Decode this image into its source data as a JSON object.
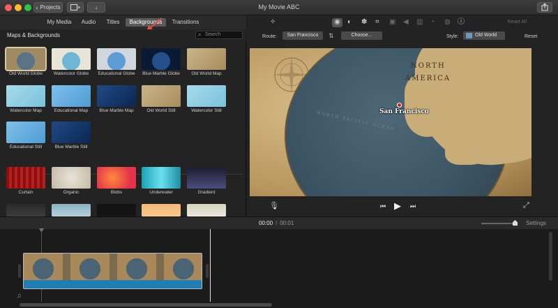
{
  "window": {
    "title": "My Movie ABC",
    "projects_label": "Projects"
  },
  "browser": {
    "tabs": [
      "My Media",
      "Audio",
      "Titles",
      "Backgrounds",
      "Transitions"
    ],
    "active_tab": "Backgrounds",
    "section_title": "Maps & Backgrounds",
    "search_placeholder": "Search",
    "maps": [
      {
        "label": "Old World Globe",
        "selected": true
      },
      {
        "label": "Watercolor Globe"
      },
      {
        "label": "Educational Globe"
      },
      {
        "label": "Blue Marble Globe"
      },
      {
        "label": "Old World Map"
      },
      {
        "label": "Watercolor Map"
      },
      {
        "label": "Educational Map"
      },
      {
        "label": "Blue Marble Map"
      },
      {
        "label": "Old World Still"
      },
      {
        "label": "Watercolor Still"
      },
      {
        "label": "Educational Still"
      },
      {
        "label": "Blue Marble Still"
      }
    ],
    "backgrounds": [
      "Curtain",
      "Organic",
      "Blobs",
      "Underwater",
      "Gradient"
    ]
  },
  "viewer": {
    "reset_all": "Reset All",
    "route_label": "Route:",
    "route_value": "San Francisco",
    "choose_label": "Choose...",
    "style_label": "Style:",
    "style_value": "Old World",
    "reset_label": "Reset",
    "map_labels": {
      "continent_line1": "NORTH",
      "continent_line2": "AMERICA",
      "ocean": "NORTH PACIFIC OCEAN",
      "city": "San Francisco"
    }
  },
  "timeline": {
    "current_time": "00:00",
    "separator": "/",
    "duration": "00:01",
    "settings_label": "Settings"
  },
  "colors": {
    "accent_arrow": "#e8503a",
    "clip_audio": "#1f7eb3",
    "pin": "#d42222"
  }
}
